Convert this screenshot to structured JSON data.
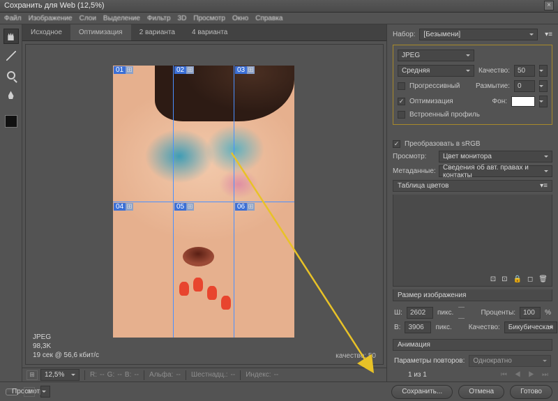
{
  "window": {
    "title": "Сохранить для Web (12,5%)"
  },
  "menu": [
    "Файл",
    "Изображение",
    "Слои",
    "Выделение",
    "Фильтр",
    "3D",
    "Просмотр",
    "Окно",
    "Справка"
  ],
  "tabs": {
    "original": "Исходное",
    "optimized": "Оптимизация",
    "two": "2 варианта",
    "four": "4 варианта"
  },
  "preset": {
    "label": "Набор:",
    "value": "[Безымени]"
  },
  "settings": {
    "format": "JPEG",
    "quality_preset": "Средняя",
    "quality_label": "Качество:",
    "quality": "50",
    "progressive": "Прогрессивный",
    "blur_label": "Размытие:",
    "blur": "0",
    "optimize": "Оптимизация",
    "matte_label": "Фон:",
    "embed_profile": "Встроенный профиль"
  },
  "srgb": {
    "convert": "Преобразовать в sRGB"
  },
  "preview": {
    "label": "Просмотр:",
    "value": "Цвет монитора"
  },
  "metadata": {
    "label": "Метаданные:",
    "value": "Сведения об авт. правах и контакты"
  },
  "color_table": {
    "title": "Таблица цветов"
  },
  "image_size": {
    "title": "Размер изображения",
    "w_label": "Ш:",
    "w": "2602",
    "h_label": "В:",
    "h": "3906",
    "px": "пикс.",
    "percent_label": "Проценты:",
    "percent": "100",
    "pct": "%",
    "quality_label": "Качество:",
    "resample": "Бикубическая"
  },
  "animation": {
    "title": "Анимация",
    "repeat_label": "Параметры повторов:",
    "repeat": "Однократно",
    "frame": "1 из 1"
  },
  "slice_info": {
    "format": "JPEG",
    "size": "98,3K",
    "time": "19 сек @ 56,6 кбит/с",
    "quality_text": "качество: 50"
  },
  "statusbar": {
    "zoom": "12,5%",
    "r": "R:",
    "g": "G:",
    "b": "B:",
    "alpha": "Альфа:",
    "hex": "Шестнадц.:",
    "index": "Индекс:",
    "dash": "--"
  },
  "slices": {
    "s1": "01",
    "s2": "02",
    "s3": "03",
    "s4": "04",
    "s5": "05",
    "s6": "06"
  },
  "footer": {
    "preview": "Просмотр...",
    "save": "Сохранить...",
    "cancel": "Отмена",
    "done": "Готово"
  }
}
